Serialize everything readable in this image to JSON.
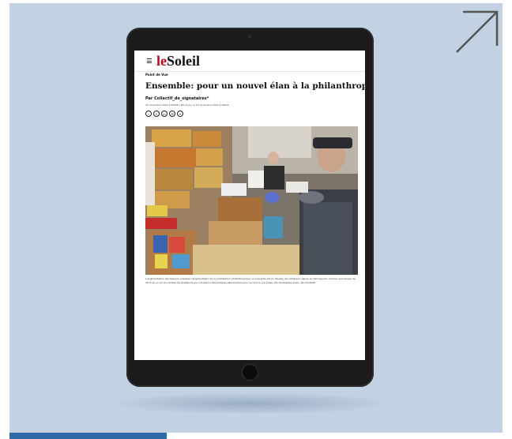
{
  "article": {
    "logo": {
      "prefix": "le",
      "name": "Soleil"
    },
    "section": "Point de Vue",
    "headline": "Ensemble: pour un nouvel élan à la philanthropie",
    "byline": "Par Collectif_de_signataires*",
    "dates": "15 novembre 2023 à 06h08  |  Mis à jour le 15 novembre 2023 à 16h24",
    "share_icons": [
      "facebook-icon",
      "x-icon",
      "linkedin-icon",
      "email-icon",
      "link-icon"
    ],
    "share_glyphs": [
      "f",
      "X",
      "in",
      "✉",
      "⚭"
    ],
    "caption": "L’augmentation des besoins surpasse l’augmentation de la contribution philanthropique. La précarité est en hausse, de nombreux signes en témoignent, comme une hausse de 30 % en un an du nombre de Québécois qui ont besoin des banques alimentaires pour se nourrir. (Le Soleil, Yan Doublet/Le Soleil, Yan Doublet)"
  },
  "colors": {
    "background": "#c3d2e2",
    "accent": "#2e6aa7",
    "logo_red": "#d0021b",
    "device": "#1b1b1b"
  },
  "icons": {
    "external": "arrow-up-right-icon",
    "menu": "hamburger-menu-icon"
  }
}
